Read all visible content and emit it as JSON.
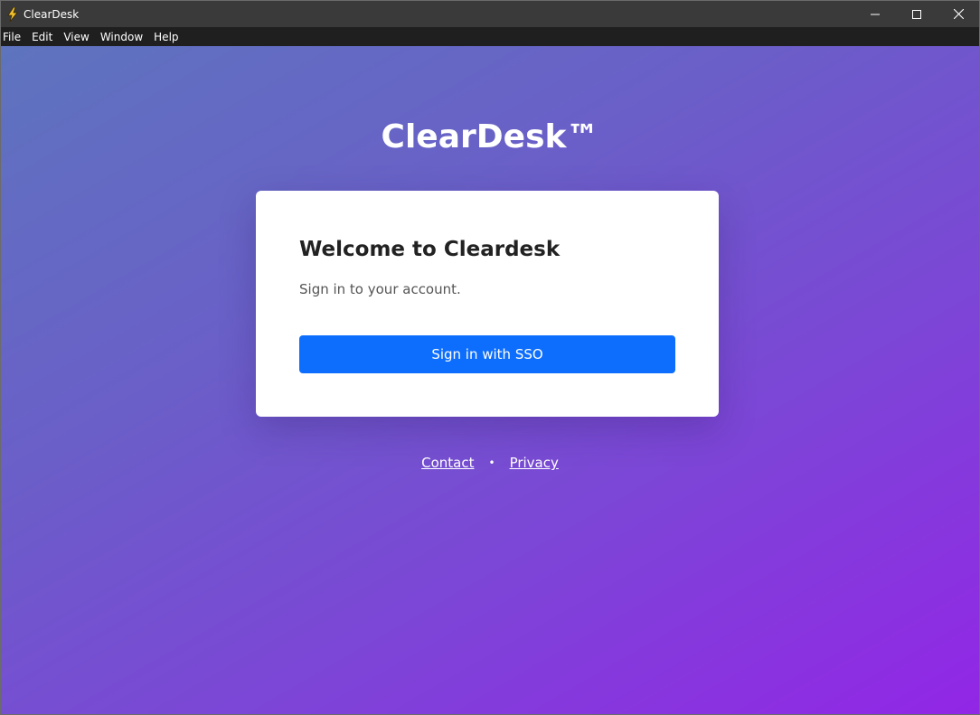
{
  "window": {
    "title": "ClearDesk",
    "controls": [
      "minimize-icon",
      "maximize-icon",
      "close-icon"
    ]
  },
  "menubar": {
    "items": [
      "File",
      "Edit",
      "View",
      "Window",
      "Help"
    ]
  },
  "brand": {
    "name": "ClearDesk™"
  },
  "card": {
    "title": "Welcome to Cleardesk",
    "subtitle": "Sign in to your account.",
    "sso_button_label": "Sign in with SSO"
  },
  "footer": {
    "contact_label": "Contact",
    "separator": "•",
    "privacy_label": "Privacy"
  },
  "colors": {
    "accent": "#0d6efd",
    "titlebar": "#3a3a3a",
    "menubar": "#1f1f1f",
    "gradient_start": "#5e74be",
    "gradient_end": "#9226e6"
  }
}
